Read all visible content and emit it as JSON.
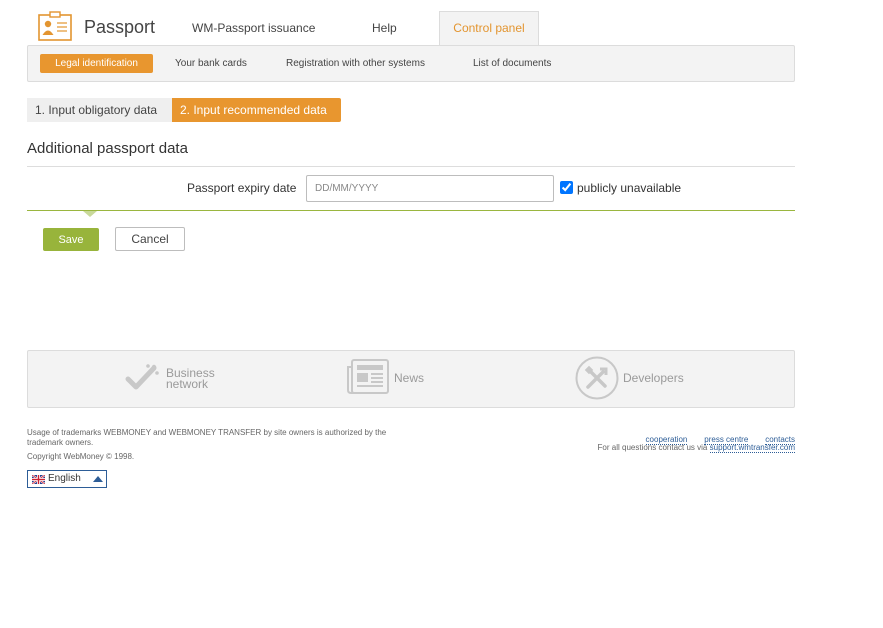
{
  "header": {
    "app_title": "Passport",
    "tabs": [
      {
        "label": "WM-Passport issuance"
      },
      {
        "label": "Help"
      },
      {
        "label": "Control panel",
        "active": true
      }
    ]
  },
  "subnav": {
    "items": [
      {
        "label": "Legal identification",
        "active": true
      },
      {
        "label": "Your bank cards"
      },
      {
        "label": "Registration with other systems"
      },
      {
        "label": "List of documents"
      }
    ]
  },
  "steps": [
    {
      "label": "1. Input obligatory data"
    },
    {
      "label": "2. Input recommended data",
      "active": true
    }
  ],
  "form": {
    "section_title": "Additional passport data",
    "field_label": "Passport expiry date",
    "field_value": "",
    "field_placeholder": "DD/MM/YYYY",
    "checkbox_label": "publicly unavailable",
    "checkbox_checked": true,
    "save_label": "Save",
    "cancel_label": "Cancel"
  },
  "footer": {
    "panel_items": [
      {
        "label_line1": "Business",
        "label_line2": "network",
        "icon": "business-network-icon"
      },
      {
        "label": "News",
        "icon": "news-icon"
      },
      {
        "label": "Developers",
        "icon": "developers-icon"
      }
    ],
    "legal_text": "Usage of trademarks WEBMONEY and WEBMONEY TRANSFER by site owners is authorized by the trademark owners.",
    "copyright": "Copyright WebMoney © 1998.",
    "links": [
      "cooperation",
      "press centre",
      "contacts"
    ],
    "contact_prefix": "For all questions contact us via",
    "contact_link": "support.wmtransfer.com",
    "language": "English"
  },
  "colors": {
    "accent_orange": "#e8962f",
    "accent_green": "#98b43b",
    "link_blue": "#2d5d97"
  }
}
